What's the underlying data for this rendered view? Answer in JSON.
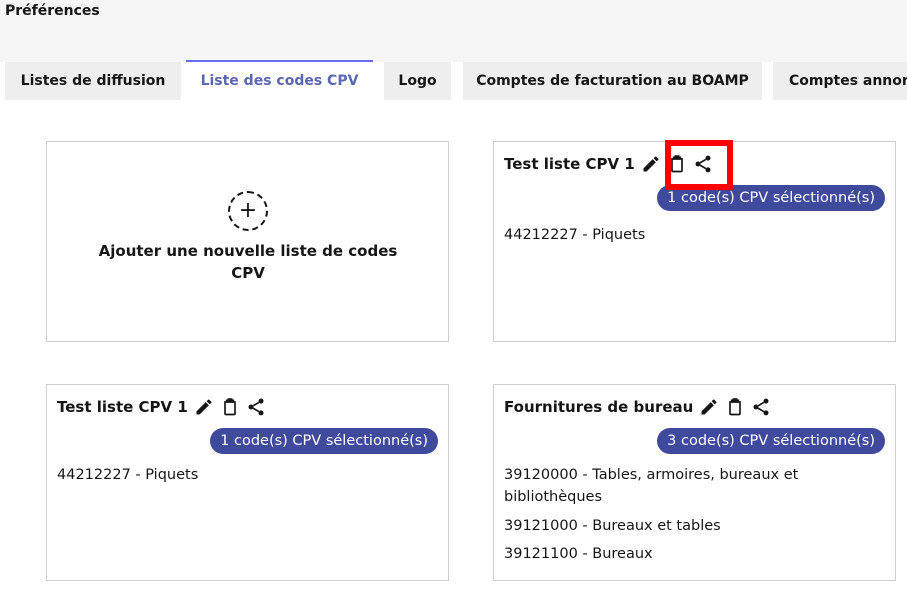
{
  "page_title": "Préférences",
  "tabs": [
    {
      "label": "Listes de diffusion",
      "active": false
    },
    {
      "label": "Liste des codes CPV",
      "active": true
    },
    {
      "label": "Logo",
      "active": false
    },
    {
      "label": "Comptes de facturation au BOAMP",
      "active": false
    },
    {
      "label": "Comptes annon",
      "active": false
    }
  ],
  "add_card": {
    "icon": "plus-circle-icon",
    "label": "Ajouter une nouvelle liste de codes CPV"
  },
  "lists": [
    {
      "title": "Test liste CPV 1",
      "badge": "1 code(s) CPV sélectionné(s)",
      "codes": [
        "44212227 - Piquets"
      ]
    },
    {
      "title": "Test liste CPV 1",
      "badge": "1 code(s) CPV sélectionné(s)",
      "codes": [
        "44212227 - Piquets"
      ]
    },
    {
      "title": "Fournitures de bureau",
      "badge": "3 code(s) CPV sélectionné(s)",
      "codes": [
        "39120000 - Tables, armoires, bureaux et bibliothèques",
        "39121000 - Bureaux et tables",
        "39121100 - Bureaux"
      ]
    }
  ],
  "icons": {
    "edit": "pencil-icon",
    "delete": "trash-icon",
    "share": "share-icon"
  },
  "colors": {
    "badge_bg": "#3f4a9c",
    "active_tab": "#5a67b3",
    "highlight": "#ff0000"
  }
}
